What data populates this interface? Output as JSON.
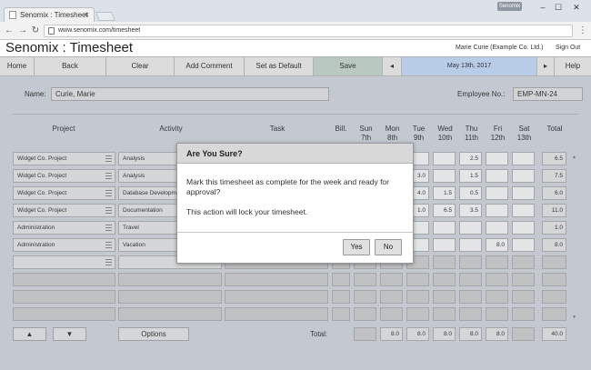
{
  "browser": {
    "tab_title": "Senomix : Timesheet",
    "tab_close": "×",
    "user_badge": "Senomix",
    "win_min": "–",
    "win_max": "☐",
    "win_close": "✕",
    "back": "←",
    "forward": "→",
    "reload": "↻",
    "url": "www.senomix.com/timesheet",
    "menu": "⋮"
  },
  "app": {
    "title": "Senomix : Timesheet",
    "user": "Marie Curie  (Example Co. Ltd.)",
    "signout": "Sign Out"
  },
  "toolbar": {
    "home": "Home",
    "back": "Back",
    "clear": "Clear",
    "add_comment": "Add Comment",
    "set_default": "Set as Default",
    "save": "Save",
    "prev": "◂",
    "date": "May 13th, 2017",
    "next": "▸",
    "help": "Help"
  },
  "form": {
    "name_label": "Name:",
    "name_value": "Curie, Marie",
    "emp_label": "Employee No.:",
    "emp_value": "EMP-MN-24"
  },
  "columns": {
    "project": "Project",
    "activity": "Activity",
    "task": "Task",
    "bill": "Bill.",
    "days": [
      {
        "d": "Sun",
        "n": "7th"
      },
      {
        "d": "Mon",
        "n": "8th"
      },
      {
        "d": "Tue",
        "n": "9th"
      },
      {
        "d": "Wed",
        "n": "10th"
      },
      {
        "d": "Thu",
        "n": "11th"
      },
      {
        "d": "Fri",
        "n": "12th"
      },
      {
        "d": "Sat",
        "n": "13th"
      }
    ],
    "total": "Total"
  },
  "rows": [
    {
      "project": "Widget Co. Project",
      "activity": "Analysis",
      "tue": "",
      "wed": "",
      "thu": "2.5",
      "fri": "",
      "sat": "",
      "total": "6.5"
    },
    {
      "project": "Widget Co. Project",
      "activity": "Analysis",
      "tue": "3.0",
      "wed": "",
      "thu": "1.5",
      "fri": "",
      "sat": "",
      "total": "7.5"
    },
    {
      "project": "Widget Co. Project",
      "activity": "Database Development",
      "tue": "4.0",
      "wed": "1.5",
      "thu": "0.5",
      "fri": "",
      "sat": "",
      "total": "6.0"
    },
    {
      "project": "Widget Co. Project",
      "activity": "Documentation",
      "tue": "1.0",
      "wed": "6.5",
      "thu": "3.5",
      "fri": "",
      "sat": "",
      "total": "11.0"
    },
    {
      "project": "Administration",
      "activity": "Travel",
      "tue": "",
      "wed": "",
      "thu": "",
      "fri": "",
      "sat": "",
      "total": "1.0"
    },
    {
      "project": "Administration",
      "activity": "Vacation",
      "tue": "",
      "wed": "",
      "thu": "",
      "fri": "8.0",
      "sat": "",
      "total": "8.0"
    }
  ],
  "footer": {
    "up": "▲",
    "down": "▼",
    "options": "Options",
    "total_label": "Total:",
    "mon": "8.0",
    "tue": "8.0",
    "wed": "8.0",
    "thu": "8.0",
    "fri": "8.0",
    "total": "40.0"
  },
  "scroll": {
    "up": "▲",
    "down": "▼"
  },
  "dialog": {
    "title": "Are You Sure?",
    "message": "Mark this timesheet as complete for the week and ready for approval?",
    "note": "This action will lock your timesheet.",
    "yes": "Yes",
    "no": "No"
  }
}
